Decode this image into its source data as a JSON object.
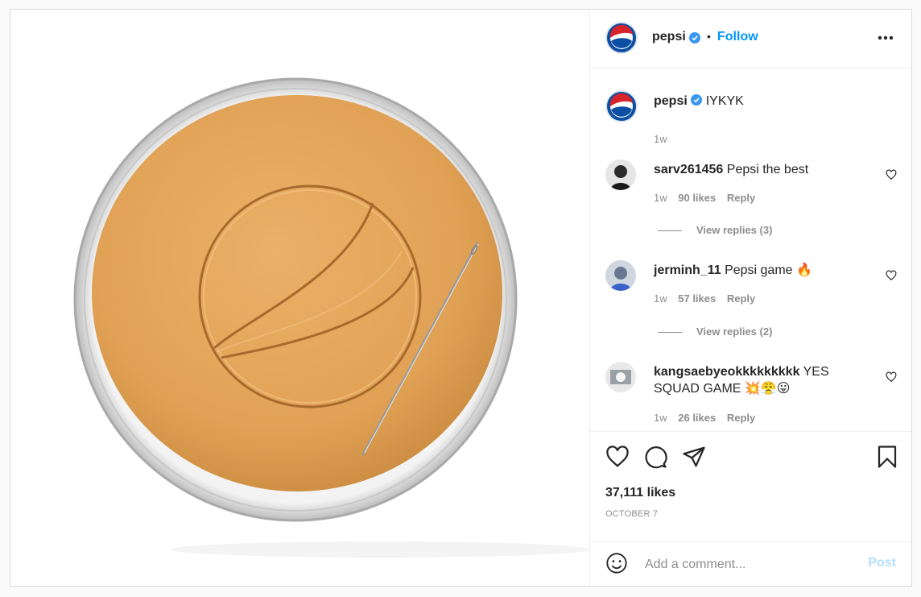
{
  "post": {
    "author": "pepsi",
    "follow_label": "Follow",
    "separator": "•",
    "more_icon": "more-horizontal-icon",
    "image_alt_icon": "dalgona-candy-pepsi-logo"
  },
  "caption": {
    "username": "pepsi",
    "text": "IYKYK",
    "time": "1w"
  },
  "comments": [
    {
      "username": "sarv261456",
      "text": "Pepsi the best",
      "time": "1w",
      "likes": "90 likes",
      "reply": "Reply",
      "view_replies": "View replies (3)"
    },
    {
      "username": "jerminh_11",
      "text": "Pepsi game 🔥",
      "time": "1w",
      "likes": "57 likes",
      "reply": "Reply",
      "view_replies": "View replies (2)"
    },
    {
      "username": "kangsaebyeokkkkkkkkk",
      "text": "YES SQUAD GAME 💥😤😛",
      "time": "1w",
      "likes": "26 likes",
      "reply": "Reply"
    }
  ],
  "engagement": {
    "likes": "37,111 likes",
    "date": "OCTOBER 7"
  },
  "add_comment": {
    "placeholder": "Add a comment...",
    "post_label": "Post"
  },
  "colors": {
    "accent": "#0095f6",
    "verified": "#3897f0",
    "post_disabled": "#b2dffc",
    "candy": "#e2a65a"
  }
}
